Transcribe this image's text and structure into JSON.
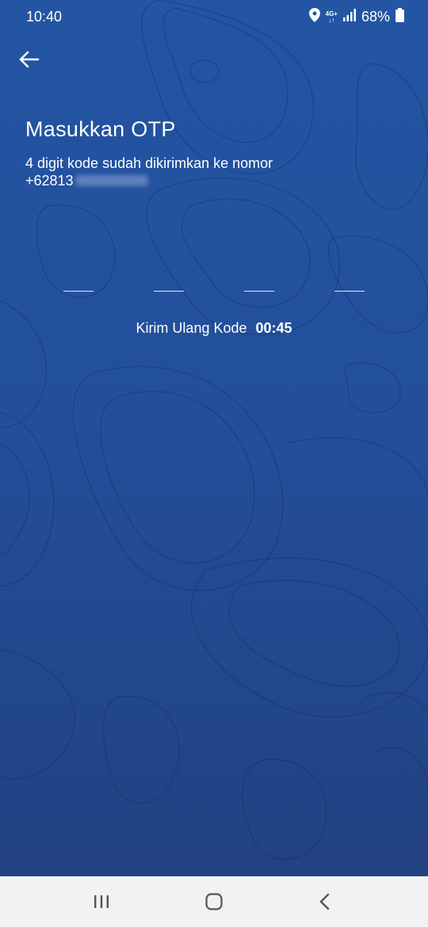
{
  "status_bar": {
    "time": "10:40",
    "network_top": "4G+",
    "network_bottom": "↓↑",
    "battery_percent": "68%",
    "icons": [
      "location-icon",
      "signal-icon",
      "battery-icon"
    ]
  },
  "header": {
    "back_icon": "arrow-left-icon"
  },
  "otp": {
    "title": "Masukkan OTP",
    "subtitle_line1": "4 digit kode sudah dikirimkan ke nomor",
    "phone_prefix": "+62813",
    "digit_count": 4,
    "digits": [
      "",
      "",
      "",
      ""
    ]
  },
  "resend": {
    "label": "Kirim Ulang Kode",
    "timer": "00:45"
  },
  "nav_bar": {
    "icons": [
      "recents-icon",
      "home-icon",
      "back-nav-icon"
    ]
  },
  "colors": {
    "background_top": "#2355a3",
    "background_bottom": "#22407f",
    "text": "#ffffff",
    "nav_background": "#f2f2f4"
  }
}
